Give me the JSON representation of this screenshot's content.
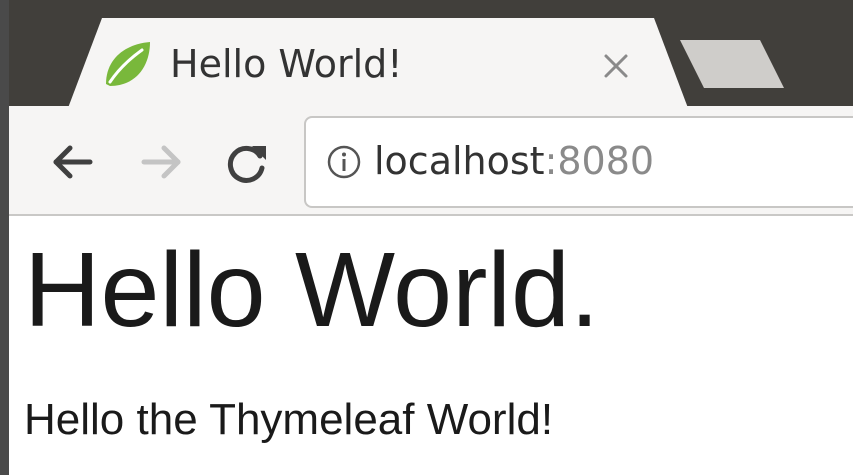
{
  "browser": {
    "tab": {
      "title": "Hello World!",
      "favicon": "spring-leaf-icon",
      "close": "close-icon"
    },
    "toolbar": {
      "back": "back-arrow-icon",
      "forward": "forward-arrow-icon",
      "reload": "reload-icon"
    },
    "address_bar": {
      "security_icon": "info-icon",
      "host": "localhost",
      "port": ":8080"
    }
  },
  "page": {
    "heading": "Hello World.",
    "paragraph": "Hello the Thymeleaf World!"
  },
  "colors": {
    "titlebar": "#413f3b",
    "tab_active": "#f6f5f4",
    "favicon": "#79b83b",
    "text": "#1a1a1a"
  }
}
